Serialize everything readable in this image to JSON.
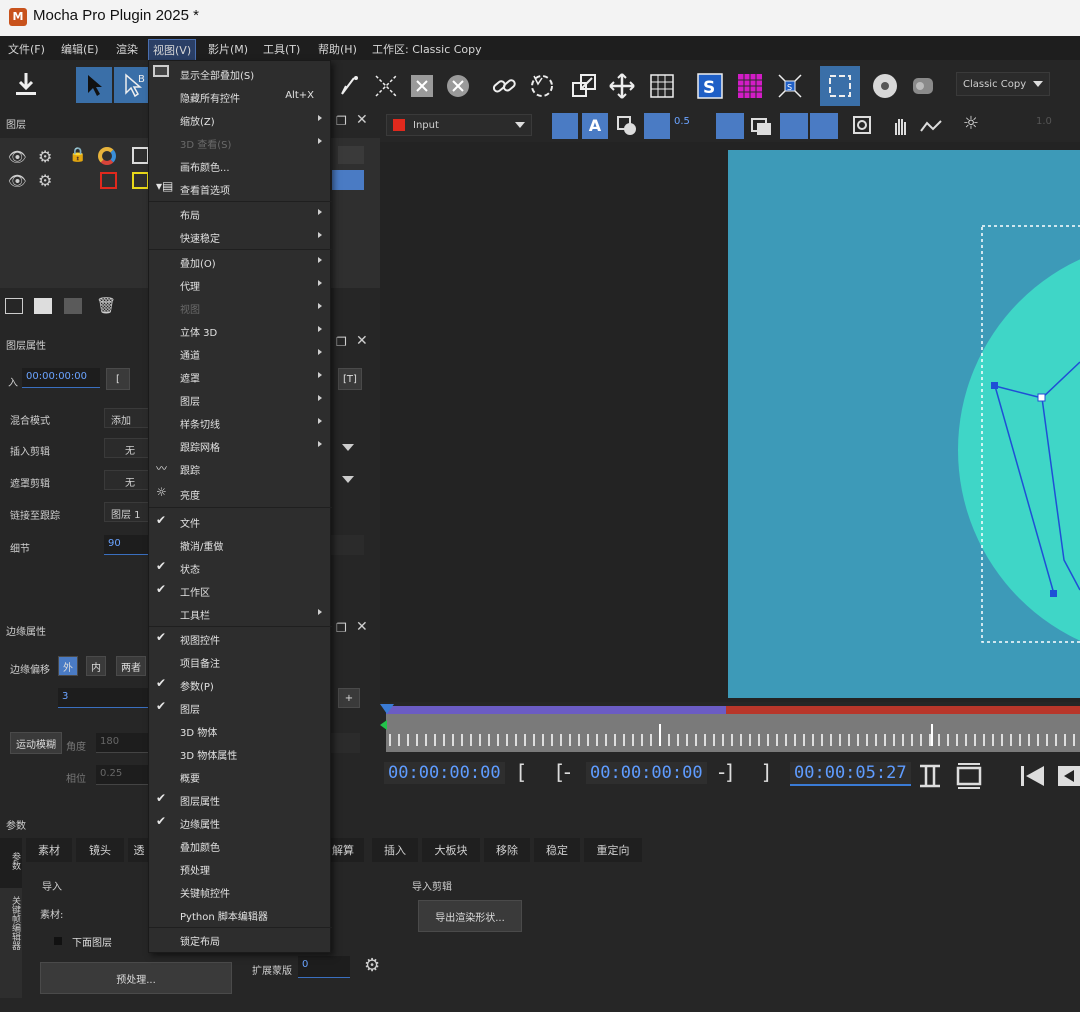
{
  "window": {
    "title": "Mocha Pro Plugin 2025 *",
    "logo": "M"
  },
  "menubar": {
    "items": [
      "文件(F)",
      "编辑(E)",
      "渲染",
      "视图(V)",
      "影片(M)",
      "工具(T)",
      "帮助(H)"
    ],
    "workspace": "工作区: Classic Copy"
  },
  "toolbar": {
    "workspace_dropdown": "Classic Copy",
    "tool_b_badge": "B"
  },
  "layers_panel": {
    "title": "图层"
  },
  "view_menu": {
    "items": [
      {
        "label": "显示全部叠加(S)",
        "icon": "monitor-icon"
      },
      {
        "label": "隐藏所有控件",
        "shortcut": "Alt+X"
      },
      {
        "label": "缩放(Z)",
        "submenu": true
      },
      {
        "label": "3D 查看(S)",
        "disabled": true,
        "submenu": true
      },
      {
        "label": "画布颜色..."
      },
      {
        "label": "查看首选项"
      },
      {
        "label": "布局",
        "submenu": true
      },
      {
        "label": "快速稳定",
        "submenu": true
      },
      {
        "label": "叠加(O)",
        "submenu": true
      },
      {
        "label": "代理",
        "submenu": true
      },
      {
        "label": "视图",
        "disabled": true,
        "submenu": true
      },
      {
        "label": "立体 3D",
        "submenu": true
      },
      {
        "label": "通道",
        "submenu": true
      },
      {
        "label": "遮罩",
        "submenu": true
      },
      {
        "label": "图层",
        "submenu": true
      },
      {
        "label": "样条切线",
        "submenu": true
      },
      {
        "label": "跟踪网格",
        "submenu": true
      },
      {
        "label": "跟踪",
        "icon": "track-icon"
      },
      {
        "label": "亮度",
        "icon": "brightness-icon"
      },
      {
        "label": "文件",
        "checked": true
      },
      {
        "label": "撤消/重做"
      },
      {
        "label": "状态",
        "checked": true
      },
      {
        "label": "工作区",
        "checked": true
      },
      {
        "label": "工具栏",
        "submenu": true
      },
      {
        "label": "视图控件",
        "checked": true
      },
      {
        "label": "项目备注"
      },
      {
        "label": "参数(P)",
        "checked": true
      },
      {
        "label": "图层",
        "checked": true
      },
      {
        "label": "3D 物体"
      },
      {
        "label": "3D 物体属性"
      },
      {
        "label": "概要"
      },
      {
        "label": "图层属性",
        "checked": true
      },
      {
        "label": "边缘属性",
        "checked": true
      },
      {
        "label": "叠加颜色"
      },
      {
        "label": "预处理"
      },
      {
        "label": "关键帧控件"
      },
      {
        "label": "Python 脚本编辑器"
      },
      {
        "label": "锁定布局"
      }
    ]
  },
  "layer_props": {
    "title": "图层属性",
    "in_label": "入",
    "in_value": "00:00:00:00",
    "blend_label": "混合模式",
    "blend_value": "添加",
    "insert_clip_label": "插入剪辑",
    "insert_clip_value": "无",
    "matte_clip_label": "遮罩剪辑",
    "matte_clip_value": "无",
    "link_track_label": "链接至跟踪",
    "link_track_value": "图层 1",
    "detail_label": "细节",
    "detail_value": "90"
  },
  "edge_props": {
    "title": "边缘属性",
    "offset_label": "边缘偏移",
    "opt_out": "外",
    "opt_in": "内",
    "opt_both": "两者",
    "offset_value": "3",
    "motion_blur_btn": "运动模糊",
    "angle_label": "角度",
    "angle_value": "180",
    "phase_label": "相位",
    "phase_value": "0.25"
  },
  "viewer": {
    "input_label": "Input",
    "opacity_value": "0.5",
    "gain_value": "1.0"
  },
  "timeline": {
    "current": "00:00:00:00",
    "in_point": "00:00:00:00",
    "out_point": "00:00:05:27",
    "bracket_in": "[",
    "bracket_in2": "[-",
    "bracket_out": "-]",
    "bracket_out2": "]"
  },
  "params": {
    "title": "参数",
    "tabs": [
      "素材",
      "镜头",
      "透",
      "解算",
      "插入",
      "大板块",
      "移除",
      "稳定",
      "重定向"
    ],
    "side_tab_1": "参数",
    "side_tab_2": "关键帧编辑器",
    "import_label": "导入",
    "clip_label": "素材:",
    "clip_value": "下面图层",
    "import_clip_label": "导入剪辑",
    "export_btn": "导出渲染形状...",
    "preprocess_btn": "预处理...",
    "expand_label": "扩展蒙版",
    "expand_value": "0"
  },
  "colors": {
    "accent": "#3a7bd5",
    "timecode": "#5f9cff",
    "clip": "#3d9ab8",
    "shape": "#3fd6c7",
    "tl_blue": "#6b5cc4",
    "tl_red": "#b8362a"
  }
}
